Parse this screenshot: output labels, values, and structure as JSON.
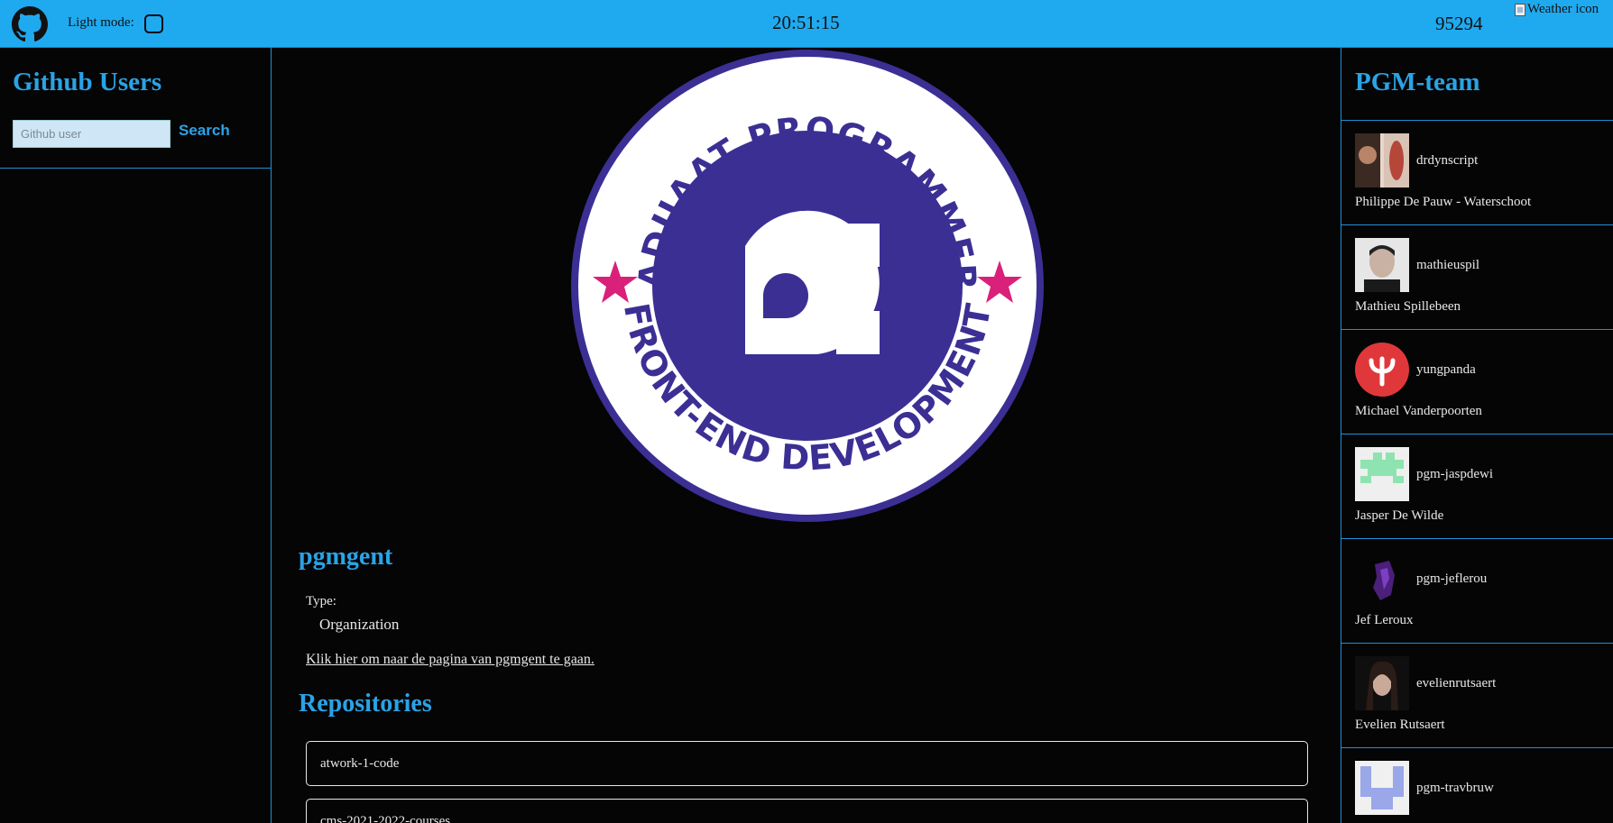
{
  "header": {
    "light_mode_label": "Light mode:",
    "clock": "20:51:15",
    "zip": "95294",
    "weather_alt": "Weather icon"
  },
  "left": {
    "title": "Github Users",
    "search_placeholder": "Github user",
    "search_label": "Search"
  },
  "main": {
    "badge": {
      "top_text": "GRADUAAT PROGRAMMEREN",
      "bottom_text": "FRONT-END DEVELOPMENT",
      "ring_color": "#3b2f94",
      "star_color": "#d9217a"
    },
    "org_name": "pgmgent",
    "type_label": "Type:",
    "type_value": "Organization",
    "link_text": "Klik hier om naar de pagina van pgmgent te gaan.",
    "repositories_title": "Repositories",
    "repositories": [
      {
        "name": "atwork-1-code"
      },
      {
        "name": "cms-2021-2022-courses"
      }
    ]
  },
  "right": {
    "title": "PGM-team",
    "members": [
      {
        "login": "drdynscript",
        "name": "Philippe De Pauw - Waterschoot"
      },
      {
        "login": "mathieuspil",
        "name": "Mathieu Spillebeen"
      },
      {
        "login": "yungpanda",
        "name": "Michael Vanderpoorten"
      },
      {
        "login": "pgm-jaspdewi",
        "name": "Jasper De Wilde"
      },
      {
        "login": "pgm-jeflerou",
        "name": "Jef Leroux"
      },
      {
        "login": "evelienrutsaert",
        "name": "Evelien Rutsaert"
      },
      {
        "login": "pgm-travbruw",
        "name": ""
      }
    ]
  },
  "colors": {
    "accent": "#2aa3e6",
    "topbar": "#1faaf0",
    "background": "#050505"
  }
}
